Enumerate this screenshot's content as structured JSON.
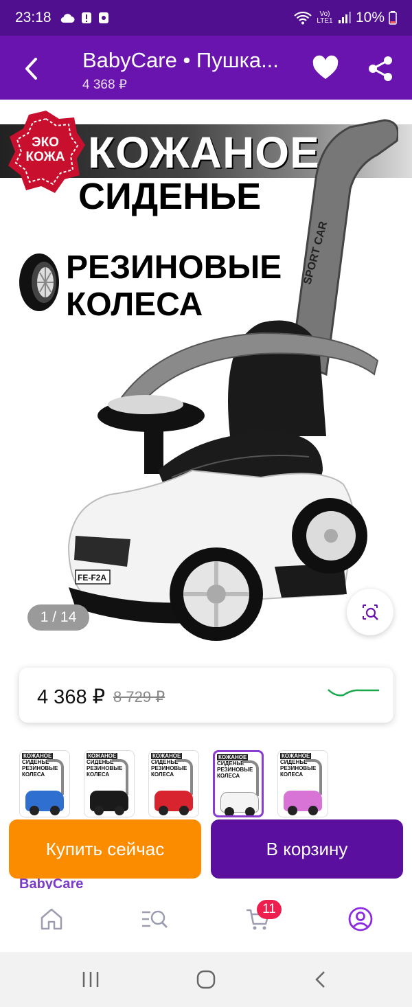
{
  "status_bar": {
    "time": "23:18",
    "lte_label": "Vo) LTE1",
    "battery": "10%"
  },
  "app_bar": {
    "title": "BabyCare • Пушка...",
    "subtitle": "4 368 ₽"
  },
  "gallery": {
    "badge_line1": "ЭКО",
    "badge_line2": "КОЖА",
    "headline1": "КОЖАНОЕ",
    "headline2": "СИДЕНЬЕ",
    "headline3": "РЕЗИНОВЫЕ",
    "headline4": "КОЛЕСА",
    "plate": "FE-F2A",
    "handle_text": "SPORT CAR",
    "counter": "1 / 14"
  },
  "price": {
    "current": "4 368 ₽",
    "old": "8 729 ₽"
  },
  "thumbnails": {
    "line1": "КОЖАНОЕ",
    "line2": "СИДЕНЬЕ",
    "line3": "РЕЗИНОВЫЕ",
    "line4": "КОЛЕСА",
    "colors": [
      "#2f6fd0",
      "#1a1a1a",
      "#d8242f",
      "#f4f4f4",
      "#d774d6"
    ]
  },
  "actions": {
    "buy_now": "Купить сейчас",
    "add_to_cart": "В корзину"
  },
  "brand": "BabyCare",
  "bottom_nav": {
    "cart_badge": "11"
  }
}
